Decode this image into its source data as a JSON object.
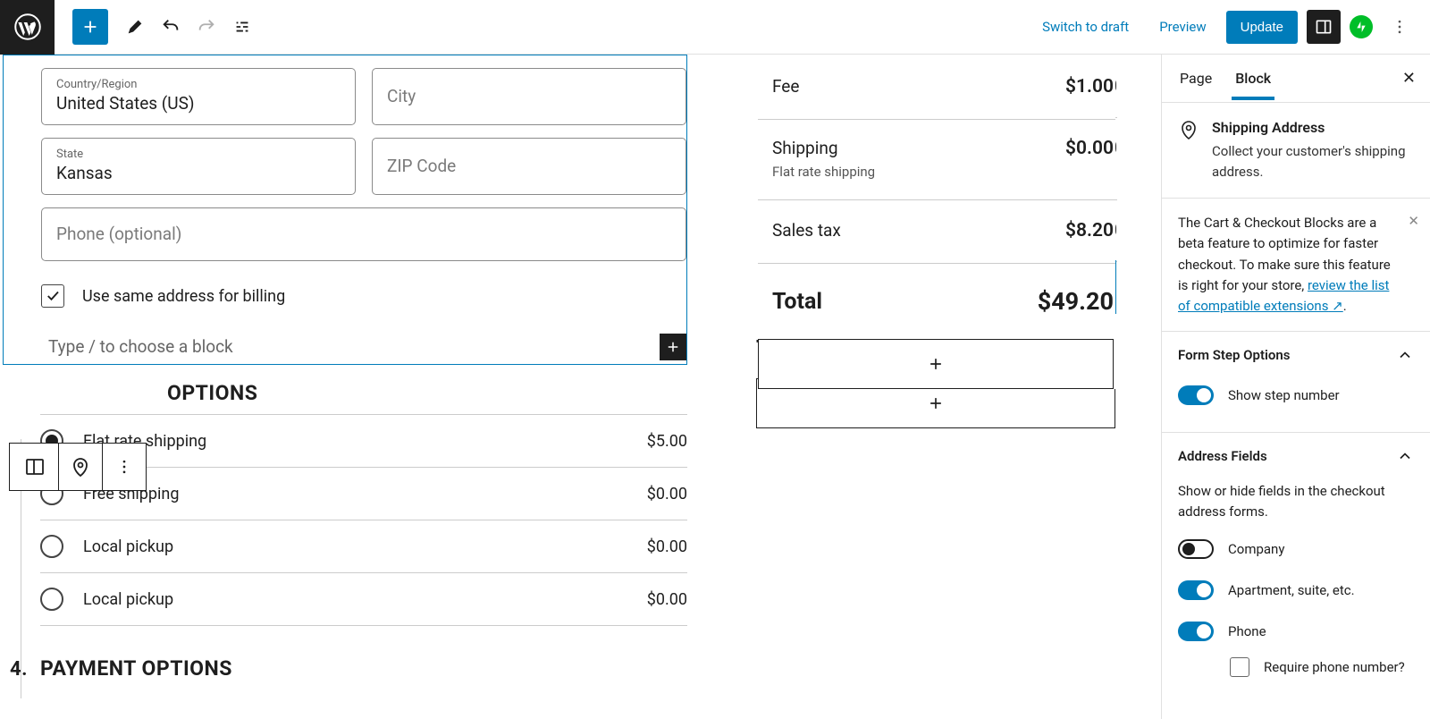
{
  "topbar": {
    "switch_draft": "Switch to draft",
    "preview": "Preview",
    "update": "Update"
  },
  "shipping_form": {
    "country_label": "Country/Region",
    "country_value": "United States (US)",
    "city_placeholder": "City",
    "state_label": "State",
    "state_value": "Kansas",
    "zip_placeholder": "ZIP Code",
    "phone_placeholder": "Phone (optional)",
    "same_address": "Use same address for billing",
    "choose_block": "Type / to choose a block"
  },
  "shipping_section": {
    "heading": "OPTIONS",
    "num": "",
    "options": [
      {
        "label": "Flat rate shipping",
        "price": "$5.00",
        "selected": true
      },
      {
        "label": "Free shipping",
        "price": "$0.00",
        "selected": false
      },
      {
        "label": "Local pickup",
        "price": "$0.00",
        "selected": false
      },
      {
        "label": "Local pickup",
        "price": "$0.00",
        "selected": false
      }
    ]
  },
  "payment_section": {
    "num": "4.",
    "heading": "PAYMENT OPTIONS"
  },
  "summary": {
    "rows": [
      {
        "label": "Fee",
        "value": "$1.00"
      },
      {
        "label": "Shipping",
        "sub": "Flat rate shipping",
        "value": "$0.00"
      },
      {
        "label": "Sales tax",
        "value": "$8.20"
      }
    ],
    "total_label": "Total",
    "total_value": "$49.20"
  },
  "sidebar": {
    "tab_page": "Page",
    "tab_block": "Block",
    "block_title": "Shipping Address",
    "block_desc": "Collect your customer's shipping address.",
    "notice_text": "The Cart & Checkout Blocks are a beta feature to optimize for faster checkout. To make sure this feature is right for your store, ",
    "notice_link": "review the list of compatible extensions",
    "panel1_title": "Form Step Options",
    "toggle1": "Show step number",
    "panel2_title": "Address Fields",
    "panel2_desc": "Show or hide fields in the checkout address forms.",
    "toggle_company": "Company",
    "toggle_apt": "Apartment, suite, etc.",
    "toggle_phone": "Phone",
    "require_phone": "Require phone number?"
  }
}
